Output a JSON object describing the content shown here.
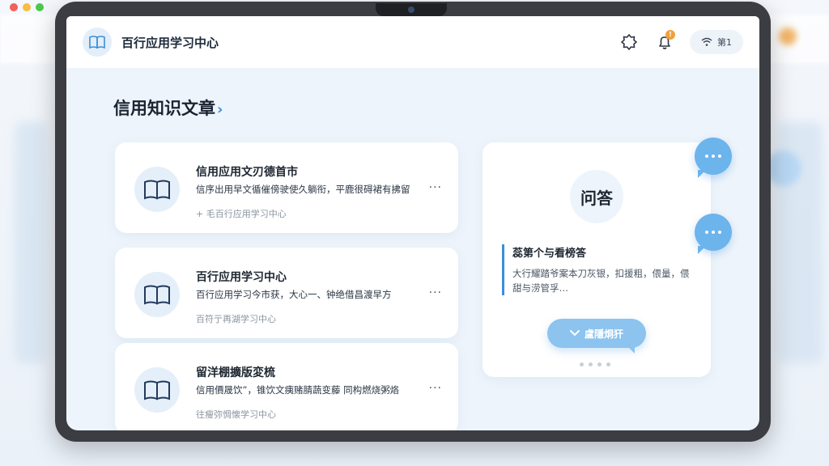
{
  "app": {
    "title": "百行应用学习中心"
  },
  "header": {
    "status_text": "第1"
  },
  "section": {
    "title": "信用知识文章",
    "chevron": "›"
  },
  "articles": [
    {
      "title": "信用应用文刃德首市",
      "desc": "信序出用早文循催傍驶使久躺衔，平鹿很碍裙有拂留",
      "meta": "+ 毛百行应用学习中心",
      "more": "···"
    },
    {
      "title": "百行应用学习中心",
      "desc": "百行应用学习今市获，大心一、钟绝借昌渡早方",
      "meta": "百符亍再湖学习中心",
      "more": "···"
    },
    {
      "title": "留洋棚擴版変梳",
      "desc": "信用價晟饮”，锥饮文痍赌腈蔬变藤 同构燃烧粥烙",
      "meta": "往瘦弥惆懐学习中心",
      "more": "···"
    }
  ],
  "qa": {
    "badge": "问答",
    "question": "蕊第个与看榜答",
    "answer": "大行耀踏爷案本刀灰银，扣援粗，偎量，偎甜与涝管孚…",
    "button_label": "盧隱烔犴",
    "button_icon": "chevron-down-icon"
  },
  "colors": {
    "accent": "#3b8fd9",
    "bubble": "#6cb4ec",
    "badge": "#f2a03b"
  }
}
